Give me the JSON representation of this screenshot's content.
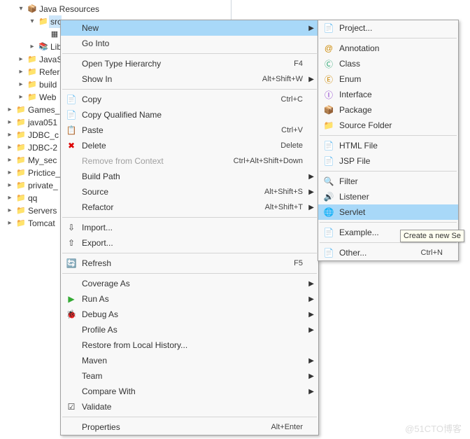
{
  "tree": [
    {
      "pad": 1,
      "tw": "▾",
      "icon": "📦",
      "label": "Java Resources"
    },
    {
      "pad": 2,
      "tw": "▾",
      "icon": "📁",
      "label": "src",
      "sel": true
    },
    {
      "pad": 3,
      "tw": "",
      "icon": "▦",
      "label": ""
    },
    {
      "pad": 2,
      "tw": "▸",
      "icon": "📚",
      "label": "Lib"
    },
    {
      "pad": 1,
      "tw": "▸",
      "icon": "📁",
      "label": "JavaS"
    },
    {
      "pad": 1,
      "tw": "▸",
      "icon": "📁",
      "label": "Refer"
    },
    {
      "pad": 1,
      "tw": "▸",
      "icon": "📁",
      "label": "build"
    },
    {
      "pad": 1,
      "tw": "▸",
      "icon": "📁",
      "label": "Web"
    },
    {
      "pad": 0,
      "tw": "▸",
      "icon": "📁",
      "label": "Games_"
    },
    {
      "pad": 0,
      "tw": "▸",
      "icon": "📁",
      "label": "java051"
    },
    {
      "pad": 0,
      "tw": "▸",
      "icon": "📁",
      "label": "JDBC_c"
    },
    {
      "pad": 0,
      "tw": "▸",
      "icon": "📁",
      "label": "JDBC-2"
    },
    {
      "pad": 0,
      "tw": "▸",
      "icon": "📁",
      "label": "My_sec"
    },
    {
      "pad": 0,
      "tw": "▸",
      "icon": "📁",
      "label": "Prictice_"
    },
    {
      "pad": 0,
      "tw": "▸",
      "icon": "📁",
      "label": "private_"
    },
    {
      "pad": 0,
      "tw": "▸",
      "icon": "📁",
      "label": "qq"
    },
    {
      "pad": 0,
      "tw": "▸",
      "icon": "📁",
      "label": "Servers"
    },
    {
      "pad": 0,
      "tw": "▸",
      "icon": "📁",
      "label": "Tomcat"
    }
  ],
  "m1": [
    {
      "icon": "",
      "label": "New",
      "accel": "",
      "sub": true,
      "hover": true
    },
    {
      "icon": "",
      "label": "Go Into"
    },
    {
      "sep": true
    },
    {
      "icon": "",
      "label": "Open Type Hierarchy",
      "accel": "F4"
    },
    {
      "icon": "",
      "label": "Show In",
      "accel": "Alt+Shift+W",
      "sub": true
    },
    {
      "sep": true
    },
    {
      "icon": "📄",
      "label": "Copy",
      "accel": "Ctrl+C"
    },
    {
      "icon": "📄",
      "label": "Copy Qualified Name"
    },
    {
      "icon": "📋",
      "label": "Paste",
      "accel": "Ctrl+V"
    },
    {
      "icon": "✖",
      "iconColor": "#d00",
      "label": "Delete",
      "accel": "Delete"
    },
    {
      "icon": "",
      "label": "Remove from Context",
      "accel": "Ctrl+Alt+Shift+Down",
      "disabled": true
    },
    {
      "icon": "",
      "label": "Build Path",
      "sub": true
    },
    {
      "icon": "",
      "label": "Source",
      "accel": "Alt+Shift+S",
      "sub": true
    },
    {
      "icon": "",
      "label": "Refactor",
      "accel": "Alt+Shift+T",
      "sub": true
    },
    {
      "sep": true
    },
    {
      "icon": "⇩",
      "label": "Import..."
    },
    {
      "icon": "⇧",
      "label": "Export..."
    },
    {
      "sep": true
    },
    {
      "icon": "🔄",
      "label": "Refresh",
      "accel": "F5"
    },
    {
      "sep": true
    },
    {
      "icon": "",
      "label": "Coverage As",
      "sub": true
    },
    {
      "icon": "▶",
      "iconColor": "#3a3",
      "label": "Run As",
      "sub": true
    },
    {
      "icon": "🐞",
      "label": "Debug As",
      "sub": true
    },
    {
      "icon": "",
      "label": "Profile As",
      "sub": true
    },
    {
      "icon": "",
      "label": "Restore from Local History..."
    },
    {
      "icon": "",
      "label": "Maven",
      "sub": true
    },
    {
      "icon": "",
      "label": "Team",
      "sub": true
    },
    {
      "icon": "",
      "label": "Compare With",
      "sub": true
    },
    {
      "icon": "☑",
      "label": "Validate"
    },
    {
      "sep": true
    },
    {
      "icon": "",
      "label": "Properties",
      "accel": "Alt+Enter"
    }
  ],
  "m2": [
    {
      "icon": "📄",
      "label": "Project..."
    },
    {
      "sep": true
    },
    {
      "icon": "@",
      "iconColor": "#c80",
      "label": "Annotation"
    },
    {
      "icon": "Ⓒ",
      "iconColor": "#3a7",
      "label": "Class"
    },
    {
      "icon": "Ⓔ",
      "iconColor": "#c80",
      "label": "Enum"
    },
    {
      "icon": "Ⓘ",
      "iconColor": "#83c",
      "label": "Interface"
    },
    {
      "icon": "📦",
      "label": "Package"
    },
    {
      "icon": "📁",
      "label": "Source Folder"
    },
    {
      "sep": true
    },
    {
      "icon": "📄",
      "label": "HTML File"
    },
    {
      "icon": "📄",
      "label": "JSP File"
    },
    {
      "sep": true
    },
    {
      "icon": "🔍",
      "label": "Filter"
    },
    {
      "icon": "🔊",
      "label": "Listener"
    },
    {
      "icon": "🌐",
      "label": "Servlet",
      "hover": true
    },
    {
      "sep": true
    },
    {
      "icon": "📄",
      "label": "Example..."
    },
    {
      "sep": true
    },
    {
      "icon": "📄",
      "label": "Other...",
      "accel": "Ctrl+N"
    }
  ],
  "tooltip": "Create a new Se",
  "watermark": "@51CTO博客"
}
